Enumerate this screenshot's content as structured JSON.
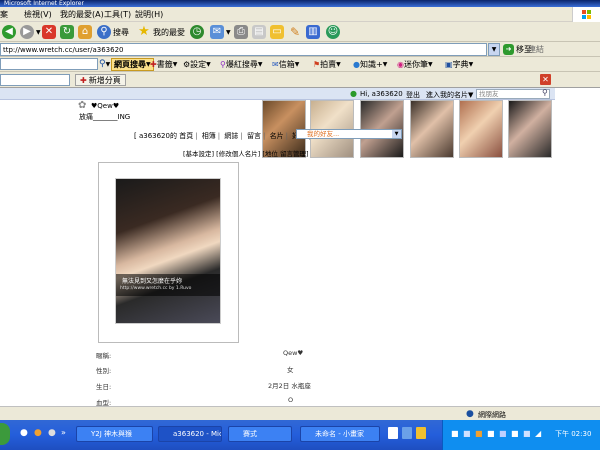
{
  "window": {
    "title_fragment": "Microsoft Internet Explorer"
  },
  "menu": {
    "items": [
      "案",
      "檢視(V)",
      "我的最愛(A)",
      "工具(T)",
      "說明(H)"
    ]
  },
  "toolbar": {
    "search": "搜尋",
    "favorites": "我的最愛"
  },
  "address": {
    "url": "ttp://www.wretch.cc/user/a363620",
    "go": "移至",
    "links": "連結"
  },
  "yahoo": {
    "web_search": "網頁搜尋",
    "items": [
      "書籤",
      "設定",
      "爆紅搜尋",
      "信箱",
      "拍賣",
      "知識+",
      "迷你筆",
      "字典"
    ]
  },
  "tabbar": {
    "new_tab": "新增分頁"
  },
  "page": {
    "top_strip": {
      "user": "Hi, a363620",
      "logout": "登出",
      "my_card": "進入我的名片▼",
      "find_friend": "找朋友"
    },
    "profile_name": "♥Qew♥",
    "status_line": "放痛_______ING",
    "nav": {
      "prefix": "[ a363620的",
      "home": "首頁",
      "album": "相簿",
      "blog": "網誌",
      "guestbook": "留言",
      "card": "名片",
      "friends": "好友",
      "video": "影"
    },
    "friend_select": "我的好友...",
    "settings_row": {
      "basic": "[基本設定]",
      "edit_card": "[修改個人名片]",
      "mid": "[地位",
      "manage": "留言管理]"
    },
    "photo_caption_1": "無法見到又怎麼在乎妳",
    "photo_caption_2": "http://www.wretch.cc by 1.Ruvo",
    "info": [
      {
        "label": "暱稱:",
        "value": "Qew♥"
      },
      {
        "label": "性別:",
        "value": "女"
      },
      {
        "label": "生日:",
        "value": "2月2日 水瓶座"
      },
      {
        "label": "血型:",
        "value": "O"
      }
    ]
  },
  "status_bar": {
    "zone": "網際網路"
  },
  "taskbar": {
    "tasks": [
      "Y2J 神木與猴",
      "a363620 - Micr...",
      "賽式",
      "未命名 - 小畫家"
    ],
    "clock": "下午 02:30"
  }
}
